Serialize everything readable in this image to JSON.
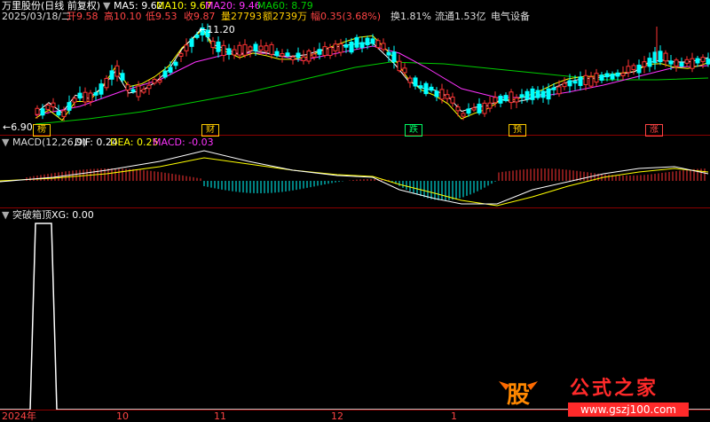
{
  "header": {
    "stock_name": "万里股份(日线 前复权)",
    "ma5": "MA5: 9.62",
    "ma10": "MA10: 9.67",
    "ma20": "MA20: 9.46",
    "ma60": "MA60: 8.79",
    "date": "2025/03/18/二",
    "open": "开9.58",
    "high": "高10.10",
    "low": "低9.53",
    "close": "收9.87",
    "volume": "量27793",
    "amount": "额2739万",
    "change": "幅0.35(3.68%)",
    "turnover": "换1.81%",
    "float_cap": "流通1.53亿",
    "sector": "电气设备"
  },
  "price_labels": {
    "high_mark": "11.20",
    "low_mark": "6.90"
  },
  "event_badges": [
    "榜",
    "财",
    "跌",
    "预",
    "涨"
  ],
  "macd": {
    "title": "MACD(12,26,9)",
    "dif": "DIF: 0.24",
    "dea": "DEA: 0.25",
    "macd": "MACD: -0.03"
  },
  "indicator": {
    "title": "突破箱顶",
    "xg": "XG: 0.00"
  },
  "time_axis": [
    "2024年",
    "10",
    "11",
    "12",
    "1"
  ],
  "watermark": {
    "icon_text": "股",
    "site_name": "公式之家",
    "url": "www.gszj100.com"
  },
  "colors": {
    "up": "#ff3333",
    "down": "#00ffff",
    "ma5": "#ffffff",
    "ma10": "#ffff00",
    "ma20": "#ff33ff",
    "ma60": "#00cc00",
    "panel_border": "#8b0000"
  }
}
